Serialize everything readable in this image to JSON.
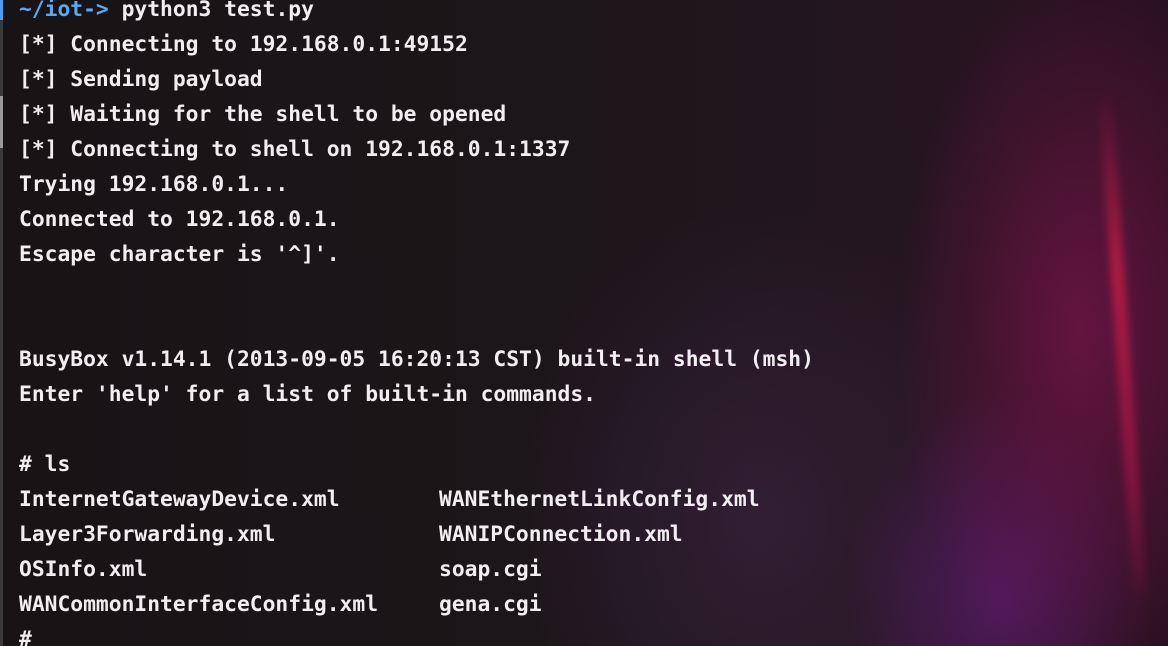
{
  "prompt": {
    "path": "~/iot->",
    "command": " python3 test.py"
  },
  "output": {
    "connect_main": "[*] Connecting to 192.168.0.1:49152",
    "sending": "[*] Sending payload",
    "waiting": "[*] Waiting for the shell to be opened",
    "connect_shell": "[*] Connecting to shell on 192.168.0.1:1337",
    "trying": "Trying 192.168.0.1...",
    "connected": "Connected to 192.168.0.1.",
    "escape": "Escape character is '^]'.",
    "busybox": "BusyBox v1.14.1 (2013-09-05 16:20:13 CST) built-in shell (msh)",
    "help_hint": "Enter 'help' for a list of built-in commands.",
    "ls_command": "# ls",
    "final_prompt": "#"
  },
  "ls_listing": [
    [
      "InternetGatewayDevice.xml",
      "WANEthernetLinkConfig.xml"
    ],
    [
      "Layer3Forwarding.xml",
      "WANIPConnection.xml"
    ],
    [
      "OSInfo.xml",
      "soap.cgi"
    ],
    [
      "WANCommonInterfaceConfig.xml",
      "gena.cgi"
    ]
  ],
  "colors": {
    "prompt": "#5aa8f0",
    "text": "#f1eef1",
    "background": "#1a1418",
    "accent_glow": "#c81e46"
  }
}
